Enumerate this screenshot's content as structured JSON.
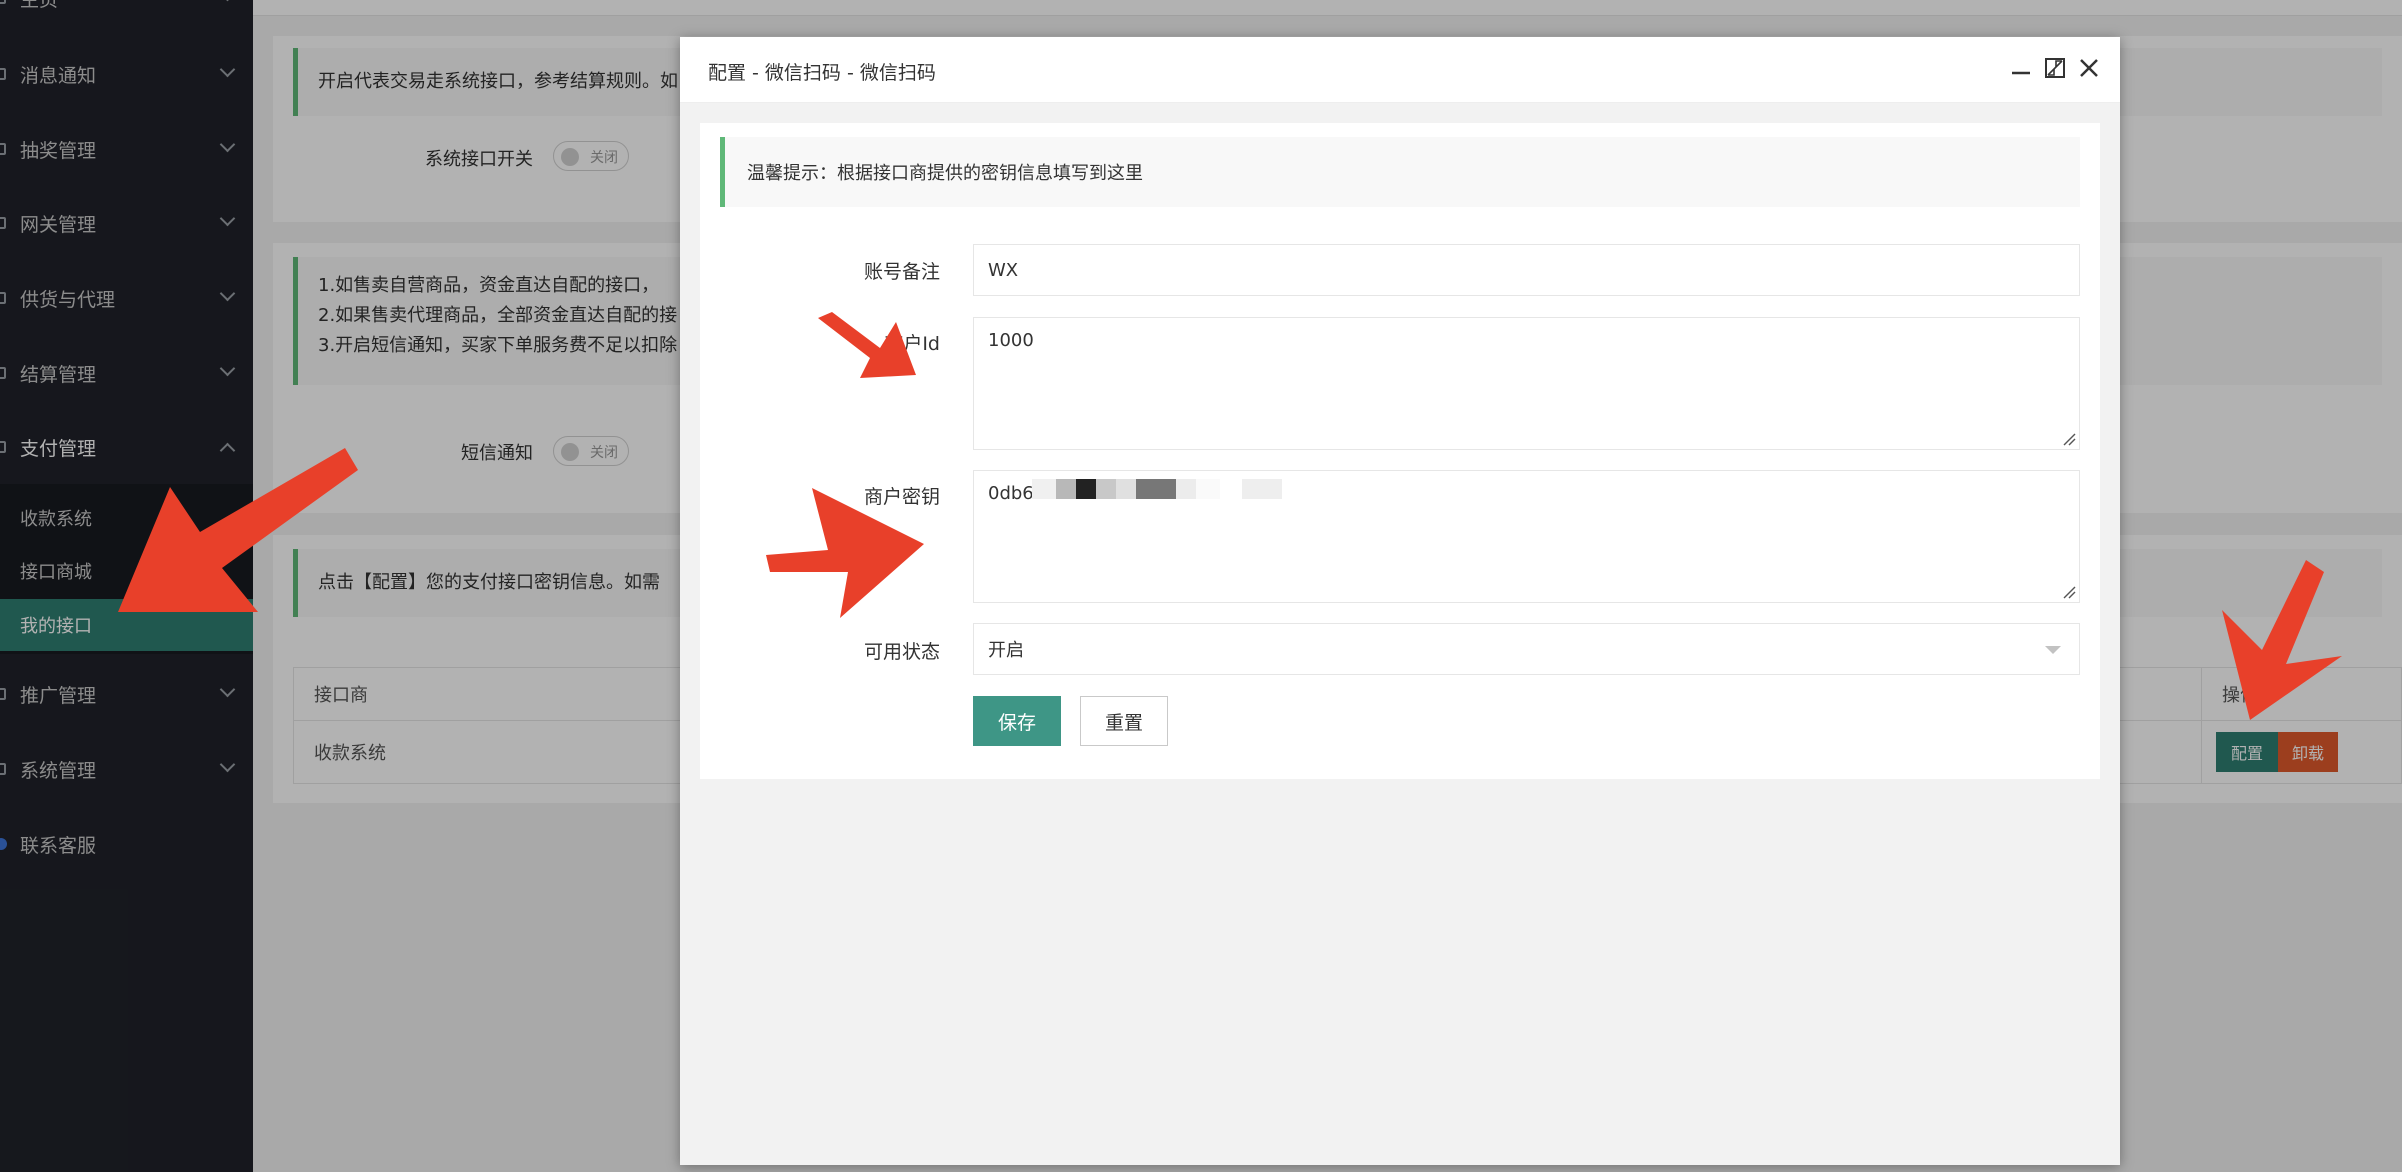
{
  "sidebar": {
    "items": [
      {
        "label": "主页"
      },
      {
        "label": "消息通知"
      },
      {
        "label": "抽奖管理"
      },
      {
        "label": "网关管理"
      },
      {
        "label": "供货与代理"
      },
      {
        "label": "结算管理"
      },
      {
        "label": "支付管理"
      },
      {
        "label": "推广管理"
      },
      {
        "label": "系统管理"
      },
      {
        "label": "联系客服"
      }
    ],
    "submenu": [
      {
        "label": "收款系统"
      },
      {
        "label": "接口商城"
      },
      {
        "label": "我的接口"
      }
    ]
  },
  "main": {
    "notice1": "开启代表交易走系统接口，参考结算规则。如",
    "system_switch_label": "系统接口开关",
    "system_switch_state": "关闭",
    "notice2_lines": [
      "1.如售卖自营商品，资金直达自配的接口，",
      "2.如果售卖代理商品，全部资金直达自配的接",
      "3.开启短信通知，买家下单服务费不足以扣除"
    ],
    "sms_switch_label": "短信通知",
    "sms_switch_state": "关闭",
    "notice3": "点击【配置】您的支付接口密钥信息。如需",
    "table": {
      "header_provider": "接口商",
      "header_actions": "操作",
      "row_provider": "收款系统",
      "btn_config": "配置",
      "btn_uninstall": "卸载"
    }
  },
  "modal": {
    "title": "配置 - 微信扫码 - 微信扫码",
    "tip": "温馨提示：根据接口商提供的密钥信息填写到这里",
    "fields": {
      "account_note_label": "账号备注",
      "account_note_value": "WX",
      "merchant_id_label": "商户Id",
      "merchant_id_value": "1000",
      "merchant_key_label": "商户密钥",
      "merchant_key_value": "0db6",
      "status_label": "可用状态",
      "status_value": "开启"
    },
    "save_label": "保存",
    "reset_label": "重置"
  },
  "colors": {
    "sidebar_bg": "#20222a",
    "active_menu": "#2f7e72",
    "primary_button": "#3e9686",
    "danger_button": "#e05a2b",
    "annotation_arrow": "#e8402a",
    "notice_border": "#5fb878"
  }
}
